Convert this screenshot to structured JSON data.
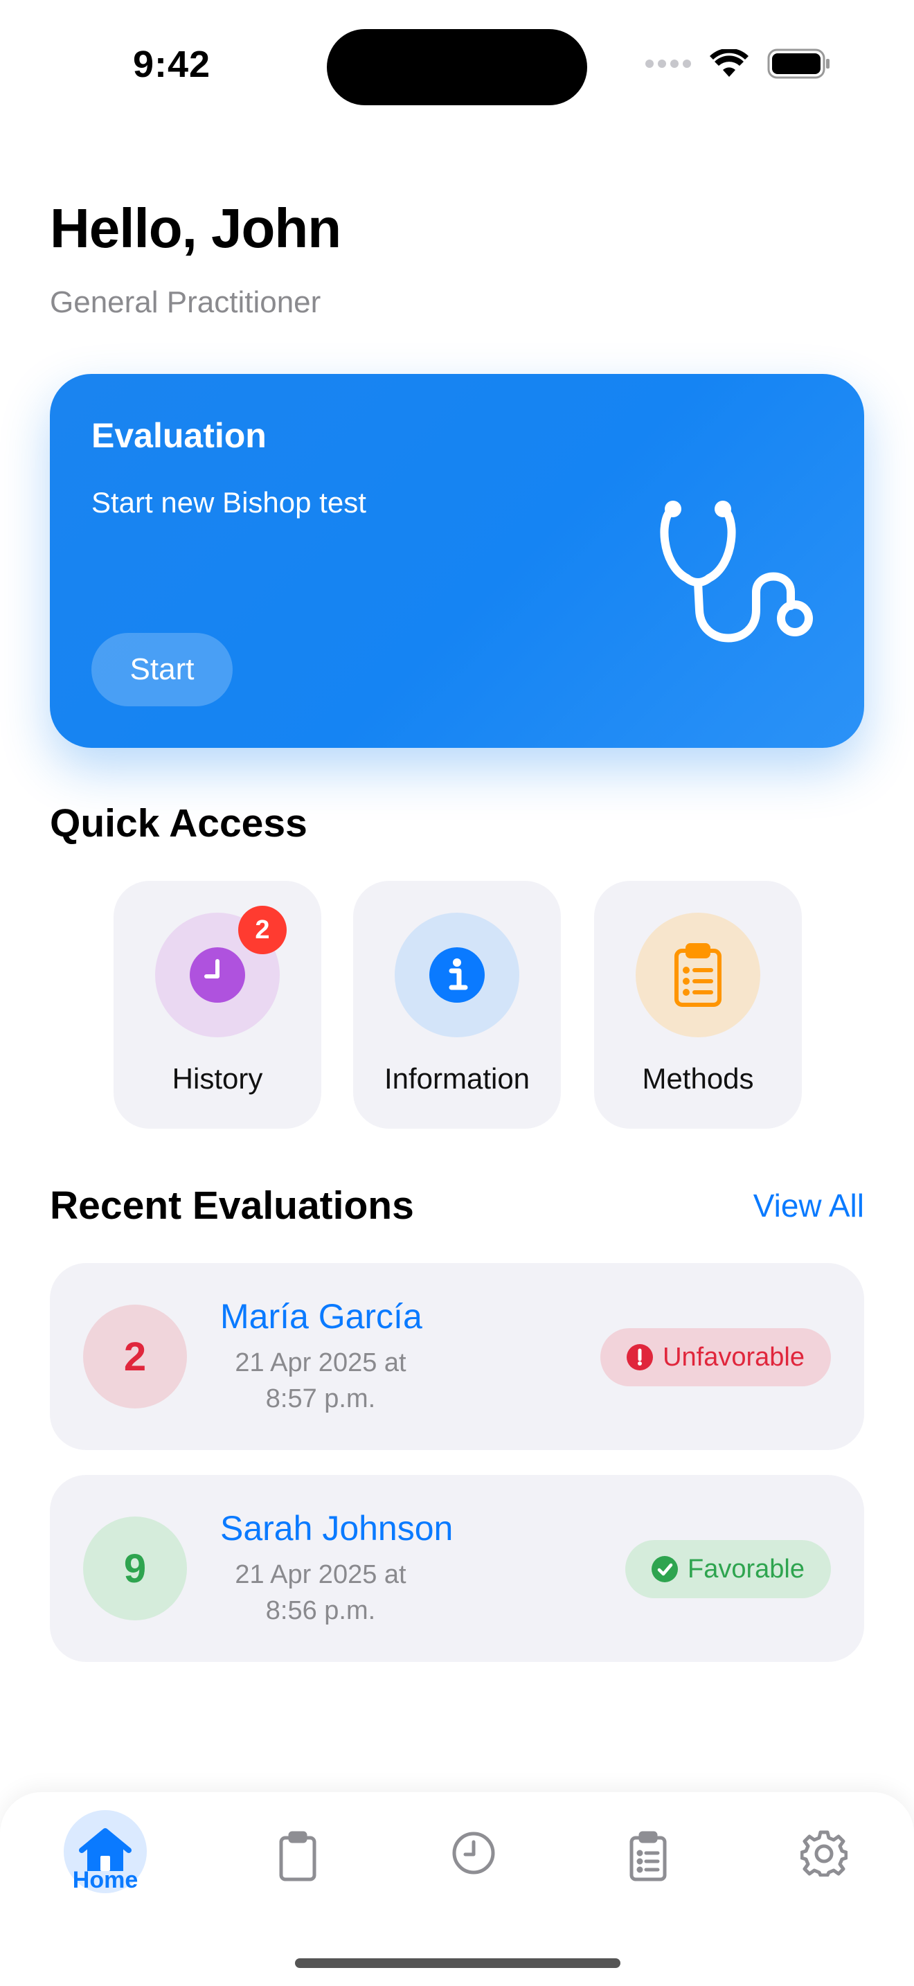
{
  "status_bar": {
    "time": "9:42"
  },
  "header": {
    "greeting": "Hello, John",
    "role": "General Practitioner"
  },
  "evaluation_card": {
    "title": "Evaluation",
    "subtitle": "Start new Bishop test",
    "button_label": "Start",
    "icon": "stethoscope-icon",
    "color": "#1584f3"
  },
  "quick_access": {
    "title": "Quick Access",
    "tiles": [
      {
        "label": "History",
        "icon": "clock-icon",
        "badge": "2",
        "color": "#af52de"
      },
      {
        "label": "Information",
        "icon": "info-icon",
        "color": "#0a7aff"
      },
      {
        "label": "Methods",
        "icon": "clipboard-list-icon",
        "color": "#ff9500"
      }
    ]
  },
  "recent_evaluations": {
    "title": "Recent Evaluations",
    "view_all_label": "View All",
    "items": [
      {
        "score": "2",
        "name": "María García",
        "date_line1": "21 Apr 2025 at",
        "date_line2": "8:57 p.m.",
        "status": "Unfavorable",
        "status_color": "#e0263c"
      },
      {
        "score": "9",
        "name": "Sarah Johnson",
        "date_line1": "21 Apr 2025 at",
        "date_line2": "8:56 p.m.",
        "status": "Favorable",
        "status_color": "#2ea44f"
      }
    ]
  },
  "tab_bar": {
    "active": "Home",
    "tabs": [
      {
        "label": "Home",
        "icon": "home-icon"
      },
      {
        "icon": "clipboard-icon"
      },
      {
        "icon": "clock-icon"
      },
      {
        "icon": "clipboard-list-icon"
      },
      {
        "icon": "gear-icon"
      }
    ]
  }
}
